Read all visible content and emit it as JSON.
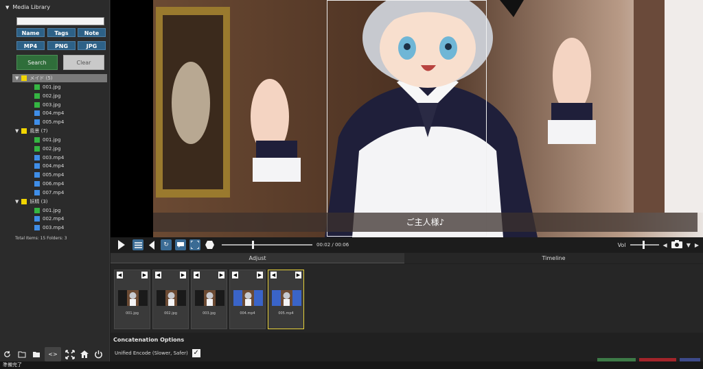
{
  "sidebar": {
    "title": "Media Library",
    "search_value": "",
    "filters": [
      "Name",
      "Tags",
      "Note",
      "MP4",
      "PNG",
      "JPG"
    ],
    "search_label": "Search",
    "clear_label": "Clear",
    "folders": [
      {
        "label": "メイド (5)",
        "files": [
          {
            "name": "001.jpg",
            "kind": "image"
          },
          {
            "name": "002.jpg",
            "kind": "image"
          },
          {
            "name": "003.jpg",
            "kind": "image"
          },
          {
            "name": "004.mp4",
            "kind": "video"
          },
          {
            "name": "005.mp4",
            "kind": "video"
          }
        ]
      },
      {
        "label": "風景 (7)",
        "files": [
          {
            "name": "001.jpg",
            "kind": "image"
          },
          {
            "name": "002.jpg",
            "kind": "image"
          },
          {
            "name": "003.mp4",
            "kind": "video"
          },
          {
            "name": "004.mp4",
            "kind": "video"
          },
          {
            "name": "005.mp4",
            "kind": "video"
          },
          {
            "name": "006.mp4",
            "kind": "video"
          },
          {
            "name": "007.mp4",
            "kind": "video"
          }
        ]
      },
      {
        "label": "妖精 (3)",
        "files": [
          {
            "name": "001.jpg",
            "kind": "image"
          },
          {
            "name": "002.mp4",
            "kind": "video"
          },
          {
            "name": "003.mp4",
            "kind": "video"
          }
        ]
      }
    ],
    "totals": "Total Items: 15  Folders: 3",
    "toolbar": {
      "toggle_label": "<>",
      "icons": [
        "refresh-icon",
        "folder-open-icon",
        "folder-icon",
        "toggle-icon",
        "fullscreen-icon",
        "home-icon",
        "power-icon"
      ]
    }
  },
  "viewer": {
    "subtitle": "ご主人様♪"
  },
  "controls": {
    "time": "00:02 / 00:06",
    "progress": 0.33,
    "volume_label": "Vol",
    "volume": 0.45
  },
  "tabs": {
    "adjust": "Adjust",
    "timeline": "Timeline"
  },
  "clips": [
    {
      "name": "001.jpg",
      "active": false,
      "bg": "dark"
    },
    {
      "name": "002.jpg",
      "active": false,
      "bg": "dark"
    },
    {
      "name": "003.jpg",
      "active": false,
      "bg": "dark"
    },
    {
      "name": "004.mp4",
      "active": false,
      "bg": "blue"
    },
    {
      "name": "005.mp4",
      "active": true,
      "bg": "blue"
    }
  ],
  "concat": {
    "title": "Concatenation Options",
    "unified_label": "Unified Encode (Slower, Safer)",
    "unified_checked": true
  },
  "status": "準備完了",
  "colors": {
    "accent_blue": "#2d6187",
    "search_green": "#2f6e3a",
    "active_clip": "#e8d23a",
    "folder_yellow": "#f1d500",
    "image_green": "#35b542",
    "video_blue": "#3f8ee8"
  }
}
